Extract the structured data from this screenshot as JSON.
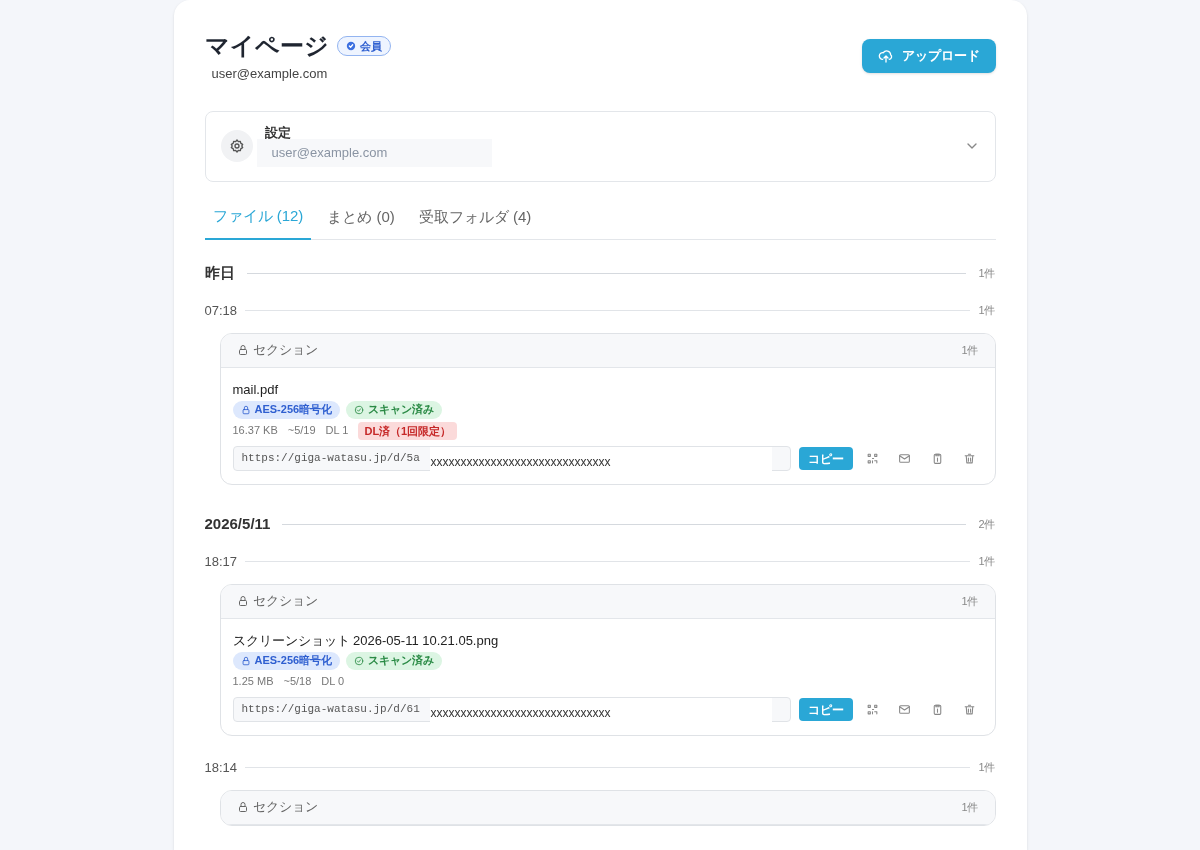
{
  "header": {
    "title": "マイページ",
    "badge": "会員",
    "email": "user@example.com",
    "upload_button": "アップロード"
  },
  "settings": {
    "title": "設定",
    "value": "user@example.com",
    "expanded": false
  },
  "tabs": [
    {
      "label": "ファイル (12)",
      "selected": true
    },
    {
      "label": "まとめ (0)",
      "selected": false
    },
    {
      "label": "受取フォルダ (4)",
      "selected": false
    }
  ],
  "days": [
    {
      "label": "昨日",
      "count": "1件",
      "times": [
        {
          "time": "07:18",
          "count": "1件",
          "sections": [
            {
              "title": "セクション",
              "count": "1件",
              "files": [
                {
                  "name": "mail.pdf",
                  "tags": [
                    {
                      "kind": "encrypted",
                      "label": "AES-256暗号化"
                    },
                    {
                      "kind": "scanned",
                      "label": "スキャン済み"
                    }
                  ],
                  "size": "16.37 KB",
                  "expiry": "~5/19",
                  "downloads": "DL 1",
                  "status": "DL済（1回限定）",
                  "url": "https://giga-watasu.jp/d/5a",
                  "mask": "xxxxxxxxxxxxxxxxxxxxxxxxxxxxxx",
                  "copy_button": "コピー"
                }
              ]
            }
          ]
        }
      ]
    },
    {
      "label": "2026/5/11",
      "count": "2件",
      "times": [
        {
          "time": "18:17",
          "count": "1件",
          "sections": [
            {
              "title": "セクション",
              "count": "1件",
              "files": [
                {
                  "name": "スクリーンショット 2026-05-11 10.21.05.png",
                  "tags": [
                    {
                      "kind": "encrypted",
                      "label": "AES-256暗号化"
                    },
                    {
                      "kind": "scanned",
                      "label": "スキャン済み"
                    }
                  ],
                  "size": "1.25 MB",
                  "expiry": "~5/18",
                  "downloads": "DL 0",
                  "url": "https://giga-watasu.jp/d/61",
                  "mask": "xxxxxxxxxxxxxxxxxxxxxxxxxxxxxx",
                  "copy_button": "コピー"
                }
              ]
            }
          ]
        },
        {
          "time": "18:14",
          "count": "1件",
          "sections": [
            {
              "title": "セクション",
              "count": "1件"
            }
          ]
        }
      ]
    }
  ]
}
